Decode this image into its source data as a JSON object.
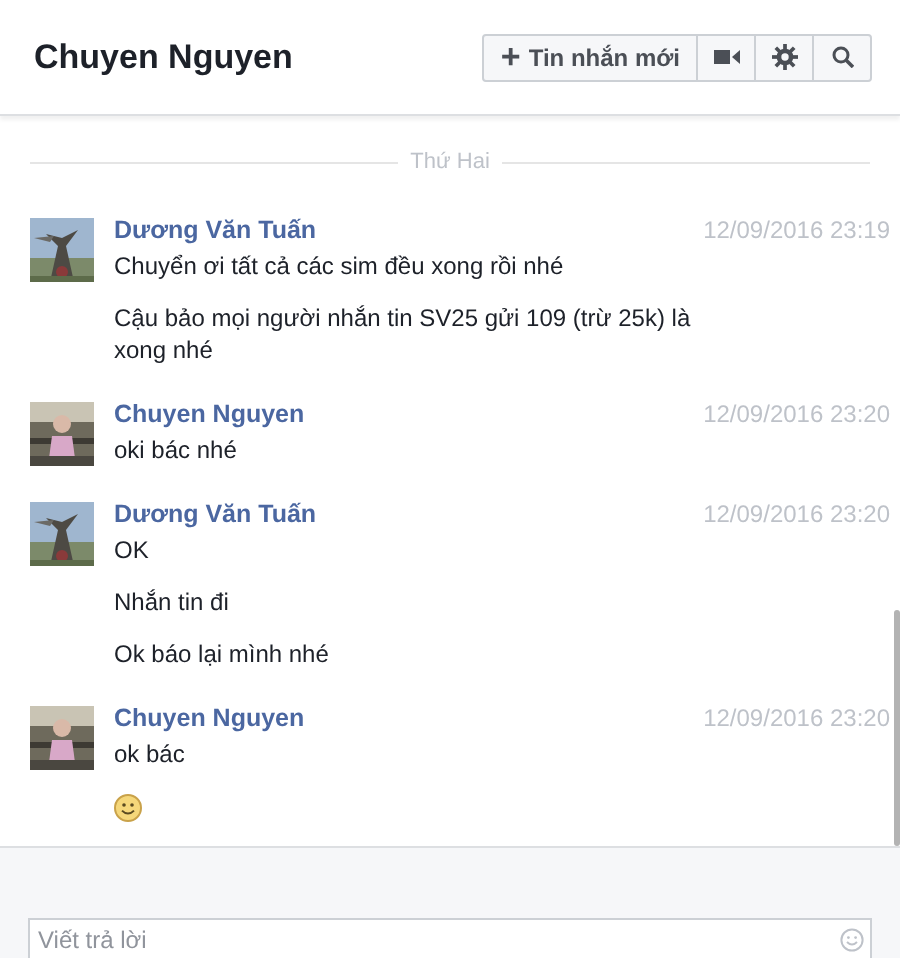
{
  "header": {
    "title": "Chuyen Nguyen",
    "new_message_button": {
      "icon": "+",
      "label": "Tin nhắn mới"
    }
  },
  "day_divider": "Thứ Hai",
  "message_groups": [
    {
      "sender": "Dương Văn Tuấn",
      "time": "12/09/2016 23:19",
      "avatar": {
        "kind": "picture"
      },
      "messages": [
        {
          "kind": "text",
          "text": "Chuyển ơi tất cả các sim đều xong rồi nhé"
        },
        {
          "kind": "text",
          "text": "Cậu bảo mọi người nhắn tin SV25 gửi 109 (trừ 25k) là xong nhé"
        }
      ]
    },
    {
      "sender": "Chuyen Nguyen",
      "time": "12/09/2016 23:20",
      "avatar": {
        "kind": "picture"
      },
      "messages": [
        {
          "kind": "text",
          "text": "oki bác nhé"
        }
      ]
    },
    {
      "sender": "Dương Văn Tuấn",
      "time": "12/09/2016 23:20",
      "avatar": {
        "kind": "picture"
      },
      "messages": [
        {
          "kind": "text",
          "text": "OK"
        },
        {
          "kind": "text",
          "text": "Nhắn tin đi"
        },
        {
          "kind": "text",
          "text": "Ok báo lại mình nhé"
        }
      ]
    },
    {
      "sender": "Chuyen Nguyen",
      "time": "12/09/2016 23:20",
      "avatar": {
        "kind": "picture"
      },
      "messages": [
        {
          "kind": "text",
          "text": "ok bác"
        },
        {
          "kind": "emoji"
        }
      ]
    }
  ],
  "composer": {
    "placeholder": "Viết trả lời"
  }
}
